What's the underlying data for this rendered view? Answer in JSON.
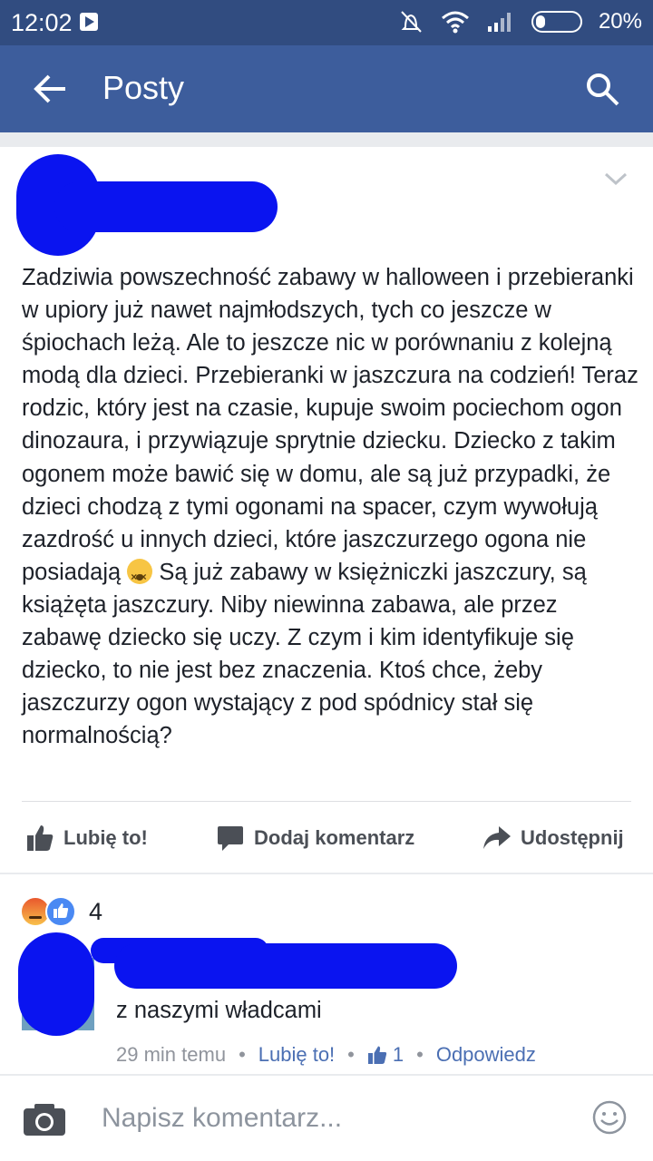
{
  "status_bar": {
    "time": "12:02",
    "battery": "20%"
  },
  "app_bar": {
    "title": "Posty"
  },
  "post": {
    "text_parts": [
      "Zadziwia powszechność zabawy w halloween i przebieranki w upiory już nawet najmłodszych, tych co jeszcze w śpiochach leżą. Ale to jeszcze nic w porównaniu z kolejną modą dla dzieci. Przebieranki w jaszczura na codzień! Teraz rodzic, który jest na czasie, kupuje swoim pociechom ogon dinozaura, i przywiązuje sprytnie dziecku. Dziecko z takim ogonem może bawić się w domu, ale są już przypadki, że dzieci chodzą z tymi ogonami na spacer, czym wywołują zazdrość u innych dzieci, które jaszczurzego ogona nie posiadają",
      " Są już zabawy w księżniczki jaszczury, są książęta jaszczury. Niby niewinna zabawa, ale przez zabawę dziecko się uczy. Z czym i kim identyfikuje się dziecko, to nie jest bez znaczenia. Ktoś chce, żeby jaszczurzy ogon wystający z pod spódnicy stał się normalnością?"
    ],
    "actions": {
      "like": "Lubię to!",
      "comment": "Dodaj komentarz",
      "share": "Udostępnij"
    }
  },
  "reactions": {
    "count": "4"
  },
  "comment": {
    "text": "z naszymi władcami",
    "time": "29 min temu",
    "like": "Lubię to!",
    "like_count": "1",
    "reply": "Odpowiedz"
  },
  "composer": {
    "placeholder": "Napisz komentarz..."
  },
  "colors": {
    "status_bar": "#314c80",
    "app_bar": "#3d5d9c",
    "link": "#4b6fb3",
    "redaction": "#0a14f0"
  }
}
